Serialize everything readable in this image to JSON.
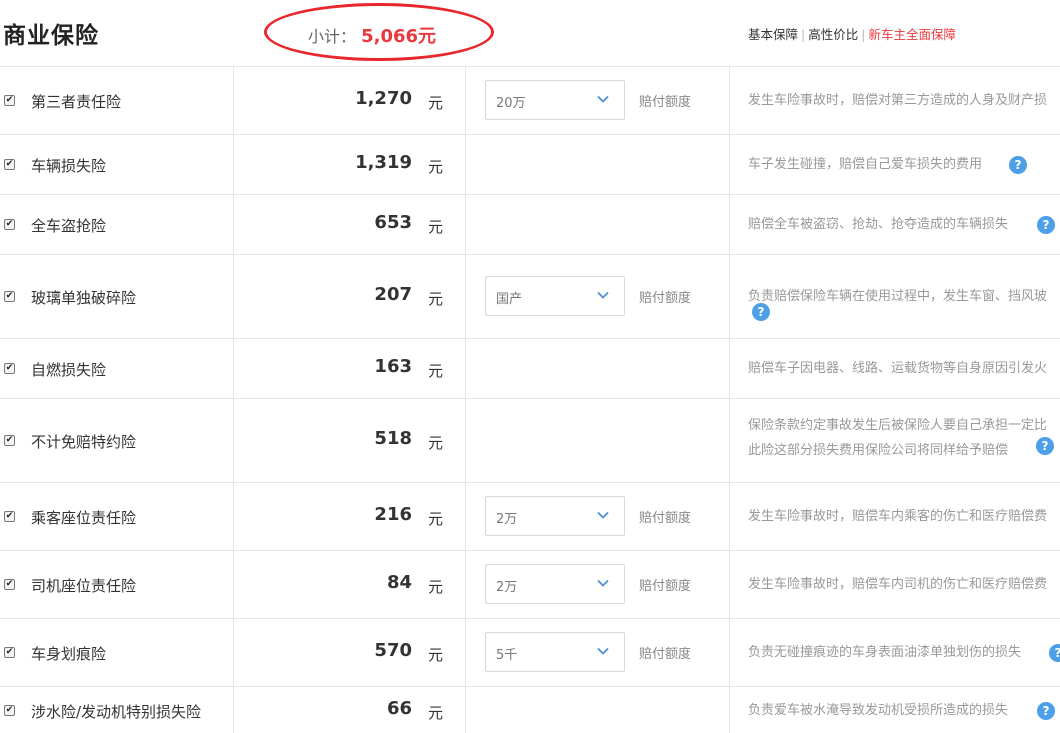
{
  "header": {
    "title": "商业保险",
    "subtotal_label": "小计：",
    "subtotal_value": "5,066元",
    "plans": [
      "基本保障",
      "高性价比",
      "新车主全面保障"
    ],
    "active_plan": "新车主全面保障",
    "accent_color": "#e8393d"
  },
  "unit_label": "元",
  "select_label": "赔付额度",
  "help_icon": "question-circle-icon",
  "items": [
    {
      "name": "第三者责任险",
      "checked": true,
      "price": "1,270",
      "select": "20万",
      "desc": "发生车险事故时，赔偿对第三方造成的人身及财产损"
    },
    {
      "name": "车辆损失险",
      "checked": true,
      "price": "1,319",
      "desc": "车子发生碰撞，赔偿自己爱车损失的费用"
    },
    {
      "name": "全车盗抢险",
      "checked": true,
      "price": "653",
      "desc": "赔偿全车被盗窃、抢劫、抢夺造成的车辆损失"
    },
    {
      "name": "玻璃单独破碎险",
      "checked": true,
      "price": "207",
      "select": "国产",
      "desc": "负责赔偿保险车辆在使用过程中，发生车窗、挡风玻"
    },
    {
      "name": "自燃损失险",
      "checked": true,
      "price": "163",
      "desc": "赔偿车子因电器、线路、运载货物等自身原因引发火"
    },
    {
      "name": "不计免赔特约险",
      "checked": true,
      "price": "518",
      "desc": "保险条款约定事故发生后被保险人要自己承担一定比",
      "desc2": "此险这部分损失费用保险公司将同样给予赔偿"
    },
    {
      "name": "乘客座位责任险",
      "checked": true,
      "price": "216",
      "select": "2万",
      "desc": "发生车险事故时，赔偿车内乘客的伤亡和医疗赔偿费"
    },
    {
      "name": "司机座位责任险",
      "checked": true,
      "price": "84",
      "select": "2万",
      "desc": "发生车险事故时，赔偿车内司机的伤亡和医疗赔偿费"
    },
    {
      "name": "车身划痕险",
      "checked": true,
      "price": "570",
      "select": "5千",
      "desc": "负责无碰撞痕迹的车身表面油漆单独划伤的损失"
    },
    {
      "name": "涉水险/发动机特别损失险",
      "checked": true,
      "price": "66",
      "desc": "负责爱车被水淹导致发动机受损所造成的损失"
    }
  ]
}
